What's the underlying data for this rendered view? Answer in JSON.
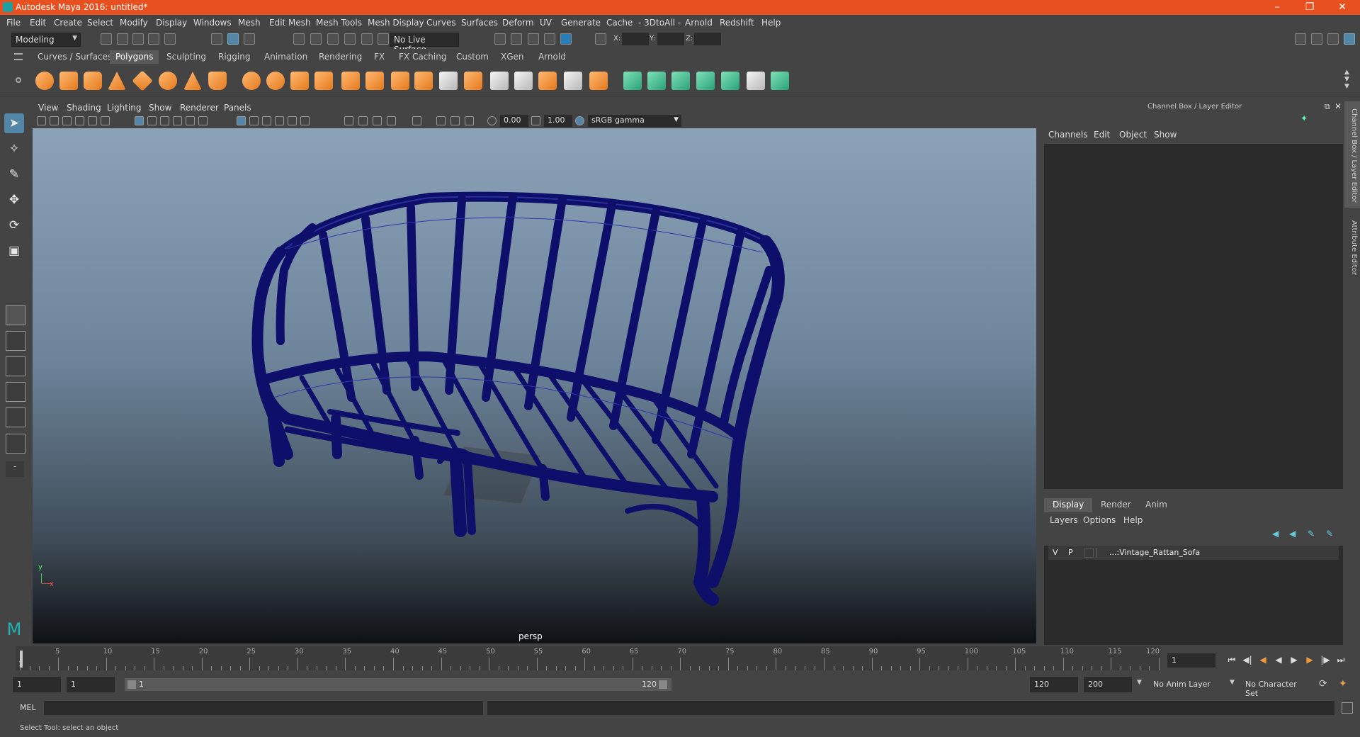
{
  "titlebar": {
    "title": "Autodesk Maya 2016: untitled*",
    "minimize_icon": "minimize-icon",
    "restore_icon": "restore-icon",
    "close_icon": "close-icon",
    "color": "#e8501f"
  },
  "menubar": {
    "items": [
      "File",
      "Edit",
      "Create",
      "Select",
      "Modify",
      "Display",
      "Windows",
      "Mesh",
      "Edit Mesh",
      "Mesh Tools",
      "Mesh Display",
      "Curves",
      "Surfaces",
      "Deform",
      "UV",
      "Generate",
      "Cache",
      "- 3DtoAll -",
      "Arnold",
      "Redshift",
      "Help"
    ]
  },
  "statusline": {
    "mode": "Modeling",
    "live_surface": "No Live Surface",
    "x_label": "X:",
    "y_label": "Y:",
    "z_label": "Z:"
  },
  "shelf": {
    "tabs": [
      "Curves / Surfaces",
      "Polygons",
      "Sculpting",
      "Rigging",
      "Animation",
      "Rendering",
      "FX",
      "FX Caching",
      "Custom",
      "XGen",
      "Arnold"
    ],
    "active_tab": "Polygons"
  },
  "viewport": {
    "menu": [
      "View",
      "Shading",
      "Lighting",
      "Show",
      "Renderer",
      "Panels"
    ],
    "exposure": "0.00",
    "gamma": "1.00",
    "color_space": "sRGB gamma",
    "camera": "persp",
    "axis_y": "y",
    "axis_x": "x",
    "wire_color": "#0d0f6a"
  },
  "channel_box": {
    "title": "Channel Box / Layer Editor",
    "menu": [
      "Channels",
      "Edit",
      "Object",
      "Show"
    ]
  },
  "side_tabs": {
    "channel_box": "Channel Box / Layer Editor",
    "attribute_editor": "Attribute Editor"
  },
  "layer_editor": {
    "tabs": [
      "Display",
      "Render",
      "Anim"
    ],
    "active_tab": "Display",
    "menu": [
      "Layers",
      "Options",
      "Help"
    ],
    "layers": [
      {
        "v": "V",
        "p": "P",
        "name": "...:Vintage_Rattan_Sofa"
      }
    ]
  },
  "timeline": {
    "ticks": [
      "1",
      "5",
      "10",
      "15",
      "20",
      "25",
      "30",
      "35",
      "40",
      "45",
      "50",
      "55",
      "60",
      "65",
      "70",
      "75",
      "80",
      "85",
      "90",
      "95",
      "100",
      "105",
      "110",
      "115",
      "120"
    ],
    "current_frame": "1"
  },
  "range": {
    "start_time": "1",
    "playback_start": "1",
    "slider_start": "1",
    "slider_end": "120",
    "playback_end": "120",
    "end_time": "200",
    "anim_layer": "No Anim Layer",
    "character_set": "No Character Set"
  },
  "command_line": {
    "language": "MEL"
  },
  "help_line": {
    "text": "Select Tool: select an object"
  }
}
